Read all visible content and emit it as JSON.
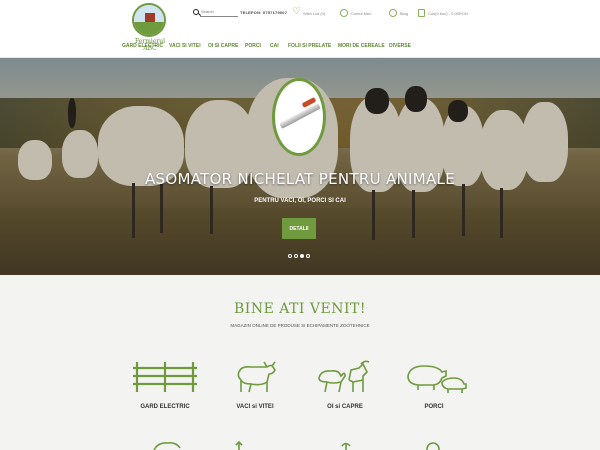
{
  "colors": {
    "brand_green": "#6f9a3e",
    "header_bg": "#ffffff",
    "section_bg": "#f3f3f1"
  },
  "header": {
    "logo_text": "Fermierul ABC",
    "search": {
      "placeholder": "Search",
      "icon": "search-icon"
    },
    "phone": "TELEFON: 0757179007",
    "links": [
      {
        "label": "Wish List (0)",
        "icon": "heart-icon"
      },
      {
        "label": "Contul Meu",
        "icon": "user-icon"
      },
      {
        "label": "Blog",
        "icon": "blog-icon"
      },
      {
        "label": "Cos(0 buc) - 0,00RON",
        "icon": "bag-icon"
      }
    ]
  },
  "nav": {
    "items": [
      "GARD ELECTRIC",
      "VACI SI VITEI",
      "OI SI CAPRE",
      "PORCI",
      "CAI",
      "FOLII SI PRELATE",
      "MORI DE CEREALE",
      "DIVERSE"
    ]
  },
  "hero": {
    "title": "ASOMATOR NICHELAT PENTRU ANIMALE",
    "subtitle": "PENTRU VACI, OI, PORCI SI CAI",
    "button": "DETALII",
    "slides": 4,
    "active_slide": 3
  },
  "welcome": {
    "title": "BINE ATI VENIT!",
    "subtitle": "MAGAZIN ONLINE DE PRODUSE SI ECHIPAMENTE ZOOTEHNICE",
    "categories": [
      {
        "label": "GARD ELECTRIC",
        "icon": "fence-icon"
      },
      {
        "label": "VACI si VITEI",
        "icon": "cow-icon"
      },
      {
        "label": "OI si CAPRE",
        "icon": "sheep-goat-icon"
      },
      {
        "label": "PORCI",
        "icon": "pig-icon"
      }
    ]
  }
}
